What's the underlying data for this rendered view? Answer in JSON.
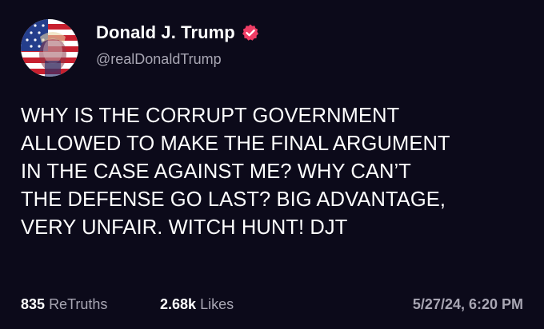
{
  "author": {
    "display_name": "Donald J. Trump",
    "handle": "@realDonaldTrump",
    "verified": true,
    "verified_color": "#ee3d65",
    "avatar_icon": "flag-portrait-avatar"
  },
  "post": {
    "text": "WHY IS THE CORRUPT GOVERNMENT\nALLOWED TO MAKE THE FINAL ARGUMENT\nIN THE CASE AGAINST ME? WHY CAN’T\nTHE DEFENSE GO LAST? BIG ADVANTAGE,\nVERY UNFAIR. WITCH HUNT! DJT"
  },
  "stats": {
    "retruths_count": "835",
    "retruths_label": "ReTruths",
    "likes_count": "2.68k",
    "likes_label": "Likes"
  },
  "timestamp": "5/27/24, 6:20 PM",
  "colors": {
    "background": "#0c0a1a",
    "text": "#ffffff",
    "muted": "#a8a6b3"
  }
}
